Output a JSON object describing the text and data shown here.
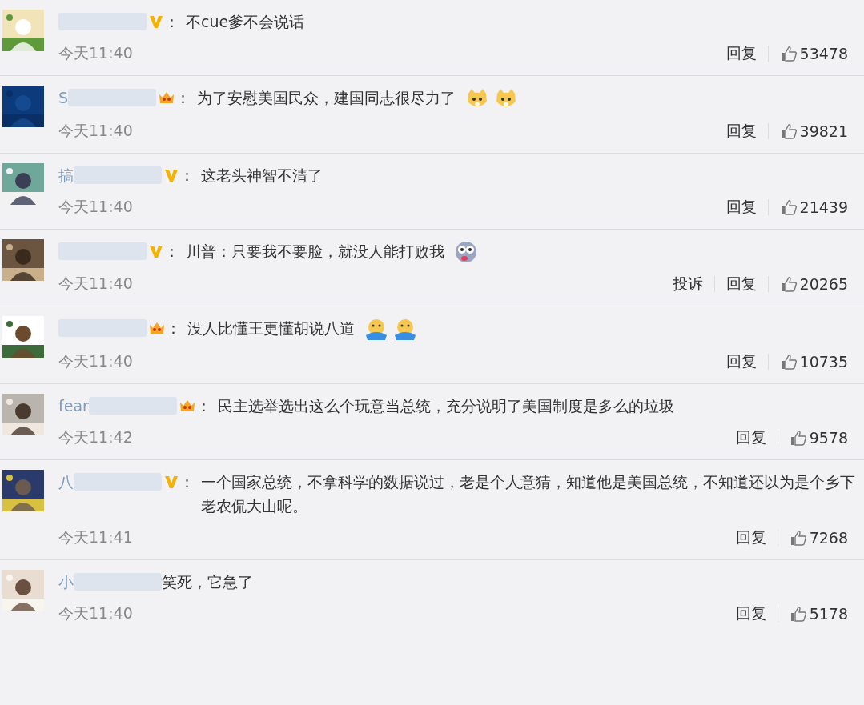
{
  "comments": [
    {
      "badge": {
        "kind": "v"
      },
      "colon": "：",
      "text": "不cue爹不会说话",
      "time": "今天11:40",
      "reply": "回复",
      "likes": "53478"
    },
    {
      "name_visible": "S",
      "badge": {
        "kind": "crown"
      },
      "colon": "：",
      "text": "为了安慰美国民众，建国同志很尽力了",
      "emojis": [
        {
          "kind": "cat"
        },
        {
          "kind": "cat"
        }
      ],
      "time": "今天11:40",
      "reply": "回复",
      "likes": "39821"
    },
    {
      "name_visible": "搞",
      "badge": {
        "kind": "v"
      },
      "colon": "：",
      "text": "这老头神智不清了",
      "time": "今天11:40",
      "reply": "回复",
      "likes": "21439"
    },
    {
      "badge": {
        "kind": "v"
      },
      "colon": "：",
      "text": "川普：只要我不要脸，就没人能打败我",
      "emojis": [
        {
          "kind": "dizzy"
        }
      ],
      "time": "今天11:40",
      "report": "投诉",
      "reply": "回复",
      "likes": "20265"
    },
    {
      "badge": {
        "kind": "crown"
      },
      "colon": "：",
      "text": "没人比懂王更懂胡说八道",
      "emojis": [
        {
          "kind": "hug"
        },
        {
          "kind": "hug"
        }
      ],
      "time": "今天11:40",
      "reply": "回复",
      "likes": "10735"
    },
    {
      "name_visible": "fear",
      "badge": {
        "kind": "crown"
      },
      "colon": "：",
      "text": "民主选举选出这么个玩意当总统，充分说明了美国制度是多么的垃圾",
      "time": "今天11:42",
      "reply": "回复",
      "likes": "9578"
    },
    {
      "name_visible": "八",
      "badge": {
        "kind": "v"
      },
      "colon": "：",
      "text": "一个国家总统，不拿科学的数据说过，老是个人意猜，知道他是美国总统，不知道还以为是个乡下老农侃大山呢。",
      "time": "今天11:41",
      "reply": "回复",
      "likes": "7268"
    },
    {
      "name_visible": "小",
      "text": "笑死，它急了",
      "time": "今天11:40",
      "reply": "回复",
      "likes": "5178"
    }
  ]
}
